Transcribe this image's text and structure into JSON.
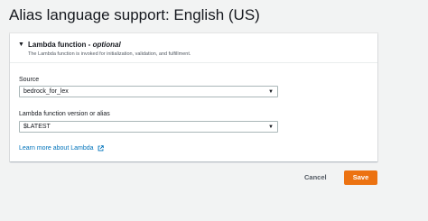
{
  "page": {
    "title": "Alias language support: English (US)"
  },
  "panel": {
    "heading": "Lambda function",
    "heading_sep": " - ",
    "heading_optional": "optional",
    "description": "The Lambda function is invoked for initialization, validation, and fulfillment."
  },
  "source": {
    "label": "Source",
    "value": "bedrock_for_lex"
  },
  "version": {
    "label": "Lambda function version or alias",
    "value": "$LATEST"
  },
  "learn_more": {
    "label": "Learn more about Lambda"
  },
  "actions": {
    "cancel_label": "Cancel",
    "save_label": "Save"
  },
  "colors": {
    "primary": "#ec7211",
    "link": "#0073bb",
    "background": "#f2f3f3"
  },
  "icons": {
    "expand": "caret-down-icon",
    "dropdown": "triangle-down-icon",
    "external": "external-link-icon"
  }
}
